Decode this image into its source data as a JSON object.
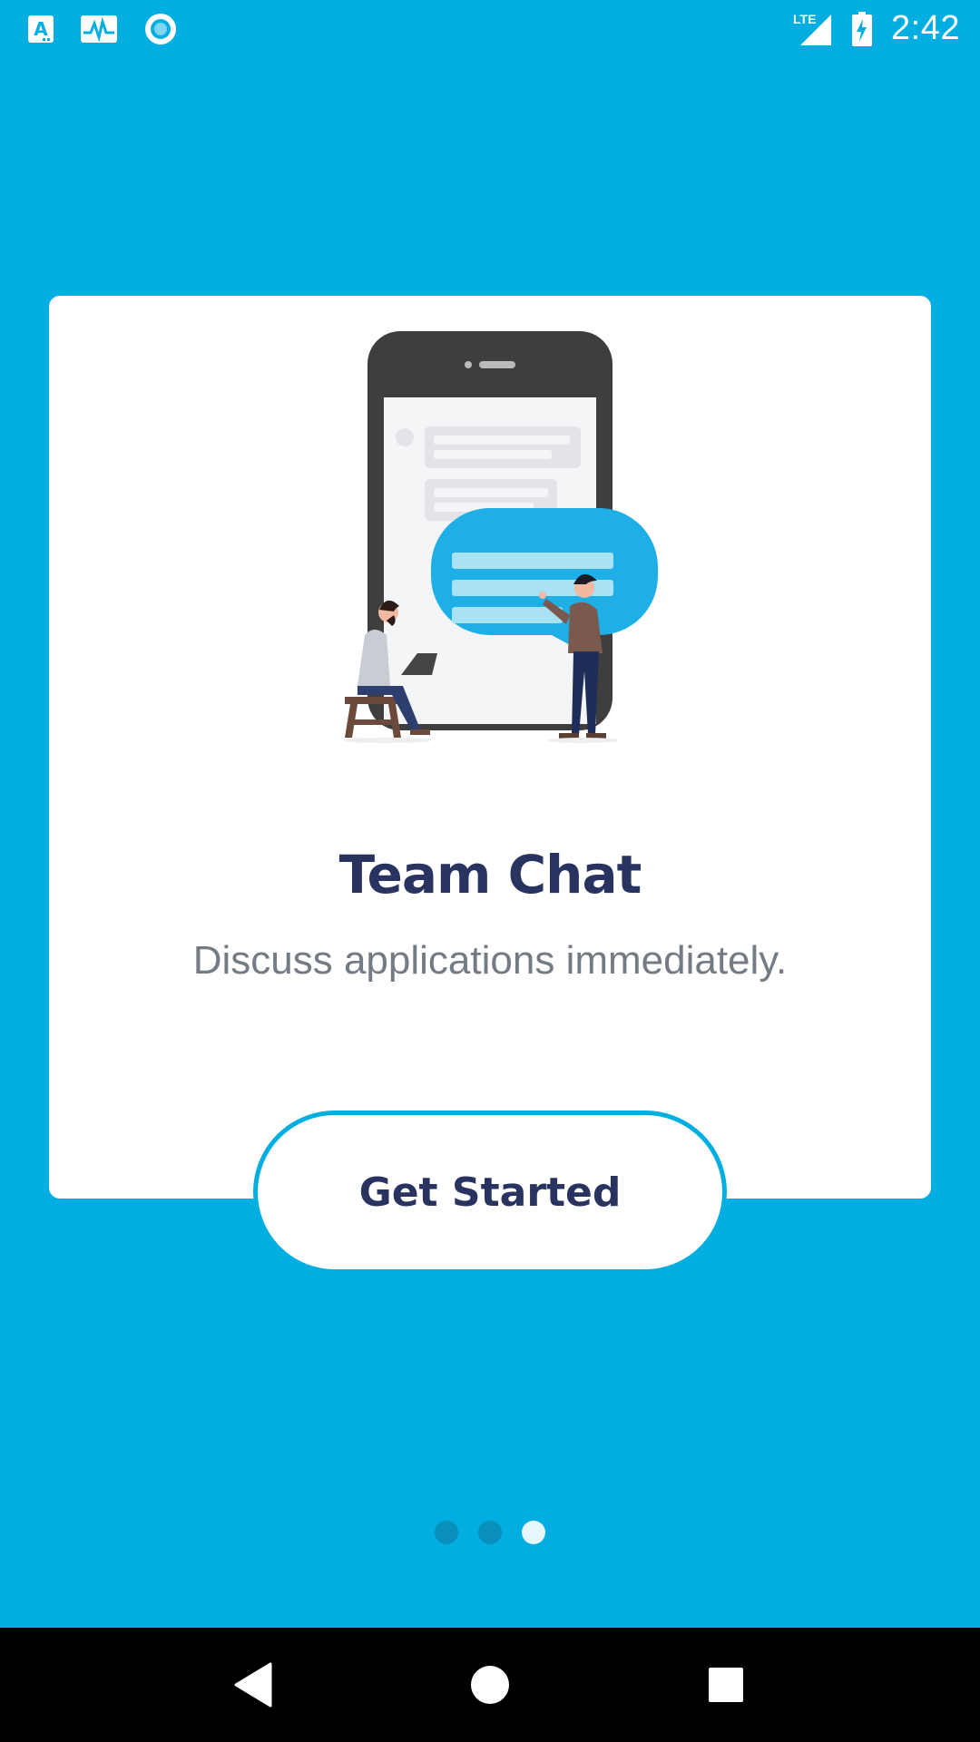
{
  "status_bar": {
    "time": "2:42",
    "network": "LTE",
    "icons": [
      "translate-app-icon",
      "activity-monitor-icon",
      "circle-app-icon",
      "lte-signal-icon",
      "battery-charging-icon"
    ]
  },
  "onboarding": {
    "title": "Team Chat",
    "subtitle": "Discuss applications immediately.",
    "cta_label": "Get Started",
    "page_indicator": {
      "total": 3,
      "active_index": 2
    }
  },
  "nav_bar": {
    "buttons": [
      "back-icon",
      "home-icon",
      "recents-icon"
    ]
  },
  "colors": {
    "background": "#00AEE2",
    "card": "#FFFFFF",
    "title": "#283360",
    "subtitle": "#747B85",
    "accent": "#00AEE2"
  }
}
